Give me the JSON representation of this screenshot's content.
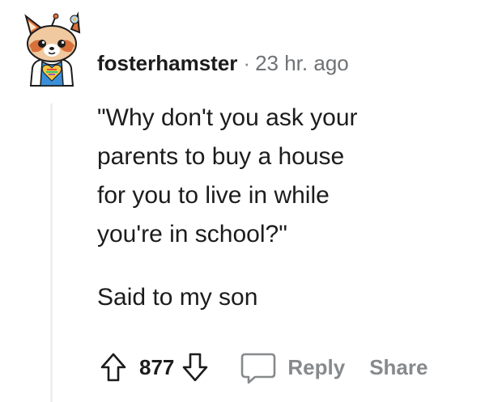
{
  "comment": {
    "author": "fosterhamster",
    "separator": "·",
    "timestamp": "23 hr. ago",
    "avatar_icon": "red-panda-snoo-avatar-icon",
    "body": {
      "quote": "\"Why don't you ask your\nparents to buy a house\nfor you to live in while\nyou're in school?\"",
      "reply": "Said to my son"
    }
  },
  "actions": {
    "upvote_icon": "upvote-arrow-icon",
    "score": "877",
    "downvote_icon": "downvote-arrow-icon",
    "comment_icon": "comment-bubble-icon",
    "reply_label": "Reply",
    "share_label": "Share"
  },
  "colors": {
    "text": "#1c1c1c",
    "meta": "#878a8c",
    "thread_line": "#edeff1"
  }
}
